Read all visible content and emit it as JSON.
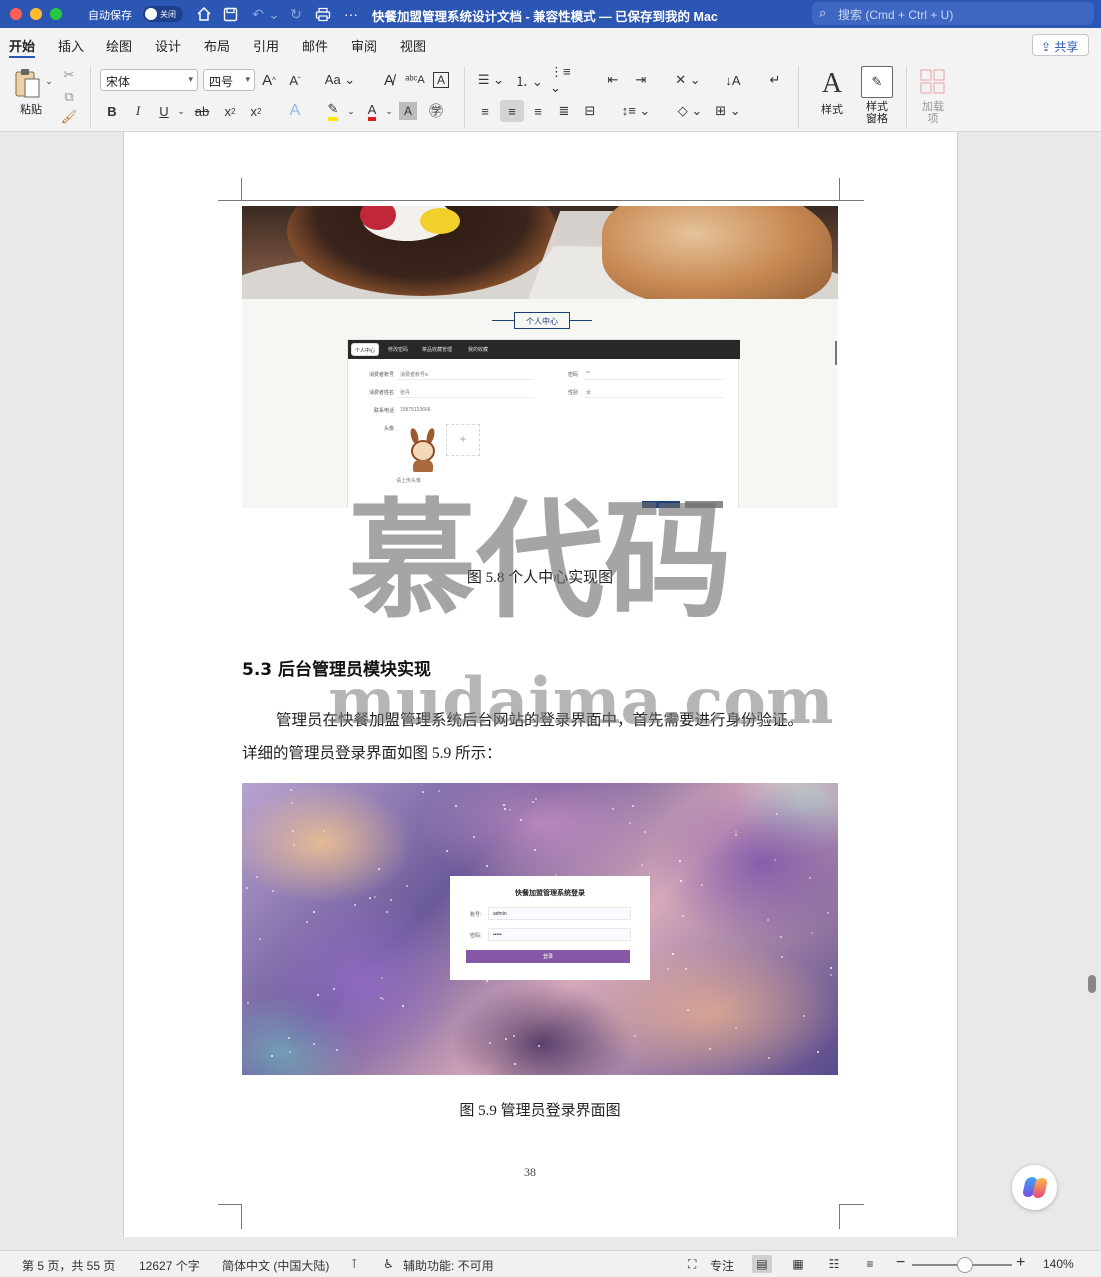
{
  "titlebar": {
    "autosave_label": "自动保存",
    "autosave_toggle": "关闭",
    "doc_title": "快餐加盟管理系统设计文档 - 兼容性模式 — 已保存到我的 Mac",
    "search_placeholder": "搜索 (Cmd + Ctrl + U)"
  },
  "tabs": [
    "开始",
    "插入",
    "绘图",
    "设计",
    "布局",
    "引用",
    "邮件",
    "审阅",
    "视图"
  ],
  "share_label": "共享",
  "ribbon": {
    "paste_label": "粘贴",
    "font_name": "宋体",
    "font_size": "四号",
    "styles_label": "样式",
    "styles_pane_label": "样式\n窗格",
    "addins_label": "加载\n项"
  },
  "document": {
    "fig58": {
      "title": "个人中心",
      "nav": [
        "个人中心",
        "修改密码",
        "菜品收藏管理",
        "我的收藏"
      ],
      "labels": [
        "消费者账号",
        "消费者姓名",
        "联系电话",
        "头像",
        "密码",
        "性别"
      ],
      "values": [
        "消费者账号a",
        "张丹",
        "15875123666",
        "**",
        "女"
      ],
      "upload_hint": "请上传头像",
      "caption": "图 5.8 个人中心实现图"
    },
    "heading": "5.3 后台管理员模块实现",
    "paragraph_line1": "管理员在快餐加盟管理系统后台网站的登录界面中，首先需要进行身份验证。",
    "paragraph_line2": "详细的管理员登录界面如图 5.9 所示：",
    "fig59": {
      "login_title": "快餐加盟管理系统登录",
      "account_label": "账号:",
      "account_value": "admin",
      "password_label": "密码:",
      "password_value": "•••••",
      "button": "登录",
      "caption": "图 5.9 管理员登录界面图"
    },
    "page_number": "38"
  },
  "watermark": {
    "cn": "慕代码",
    "en": "mudaima.com"
  },
  "statusbar": {
    "page": "第 5 页，共 55 页",
    "words": "12627 个字",
    "language": "简体中文 (中国大陆)",
    "accessibility": "辅助功能: 不可用",
    "focus": "专注",
    "zoom": "140%"
  }
}
